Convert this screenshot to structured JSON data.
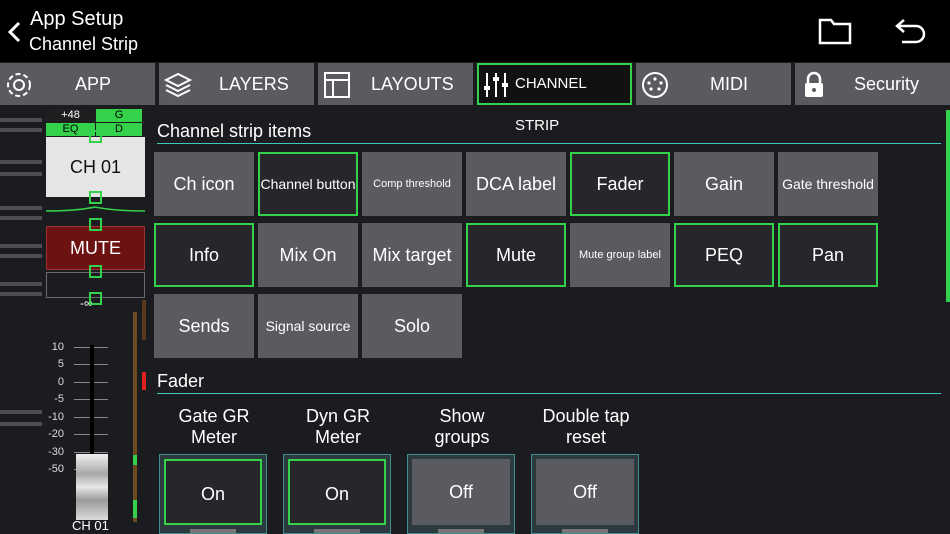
{
  "header": {
    "title": "App Setup",
    "subtitle": "Channel Strip"
  },
  "tabs": [
    {
      "label": "APP",
      "icon": "gear-icon"
    },
    {
      "label": "LAYERS",
      "icon": "layers-icon"
    },
    {
      "label": "LAYOUTS",
      "icon": "layout-icon"
    },
    {
      "label": "CHANNEL STRIP",
      "icon": "sliders-icon",
      "active": true
    },
    {
      "label": "MIDI",
      "icon": "midi-icon"
    },
    {
      "label": "Security",
      "icon": "lock-icon"
    }
  ],
  "channel": {
    "gain_badge": "+48",
    "g_badge": "G",
    "eq_badge": "EQ",
    "d_badge": "D",
    "name": "CH 01",
    "mute_label": "MUTE",
    "pan_value": "-∞",
    "bottom_label": "CH 01",
    "scale": [
      "10",
      "5",
      "0",
      "-5",
      "-10",
      "-20",
      "-30",
      "-50"
    ]
  },
  "items_section": {
    "title": "Channel strip items",
    "items": [
      {
        "label": "Ch icon",
        "on": false,
        "size": "big"
      },
      {
        "label": "Channel button",
        "on": true,
        "size": "mid"
      },
      {
        "label": "Comp threshold",
        "on": false,
        "size": "small"
      },
      {
        "label": "DCA label",
        "on": false,
        "size": "big"
      },
      {
        "label": "Fader",
        "on": true,
        "size": "big"
      },
      {
        "label": "Gain",
        "on": false,
        "size": "big"
      },
      {
        "label": "Gate threshold",
        "on": false,
        "size": "mid"
      },
      {
        "label": "Info",
        "on": true,
        "size": "big"
      },
      {
        "label": "Mix On",
        "on": false,
        "size": "big"
      },
      {
        "label": "Mix target",
        "on": false,
        "size": "big"
      },
      {
        "label": "Mute",
        "on": true,
        "size": "big"
      },
      {
        "label": "Mute group label",
        "on": false,
        "size": "small"
      },
      {
        "label": "PEQ",
        "on": true,
        "size": "big"
      },
      {
        "label": "Pan",
        "on": true,
        "size": "big"
      },
      {
        "label": "Sends",
        "on": false,
        "size": "big"
      },
      {
        "label": "Signal source",
        "on": false,
        "size": "mid"
      },
      {
        "label": "Solo",
        "on": false,
        "size": "big"
      }
    ]
  },
  "fader_section": {
    "title": "Fader",
    "options": [
      {
        "line1": "Gate GR",
        "line2": "Meter",
        "value": "On",
        "on": true
      },
      {
        "line1": "Dyn GR",
        "line2": "Meter",
        "value": "On",
        "on": true
      },
      {
        "line1": "Show",
        "line2": "groups",
        "value": "Off",
        "on": false
      },
      {
        "line1": "Double tap",
        "line2": "reset",
        "value": "Off",
        "on": false
      }
    ]
  },
  "colors": {
    "accent_green": "#34d24a",
    "section_line": "#3fc7c0",
    "mute_red": "#6c1213"
  }
}
